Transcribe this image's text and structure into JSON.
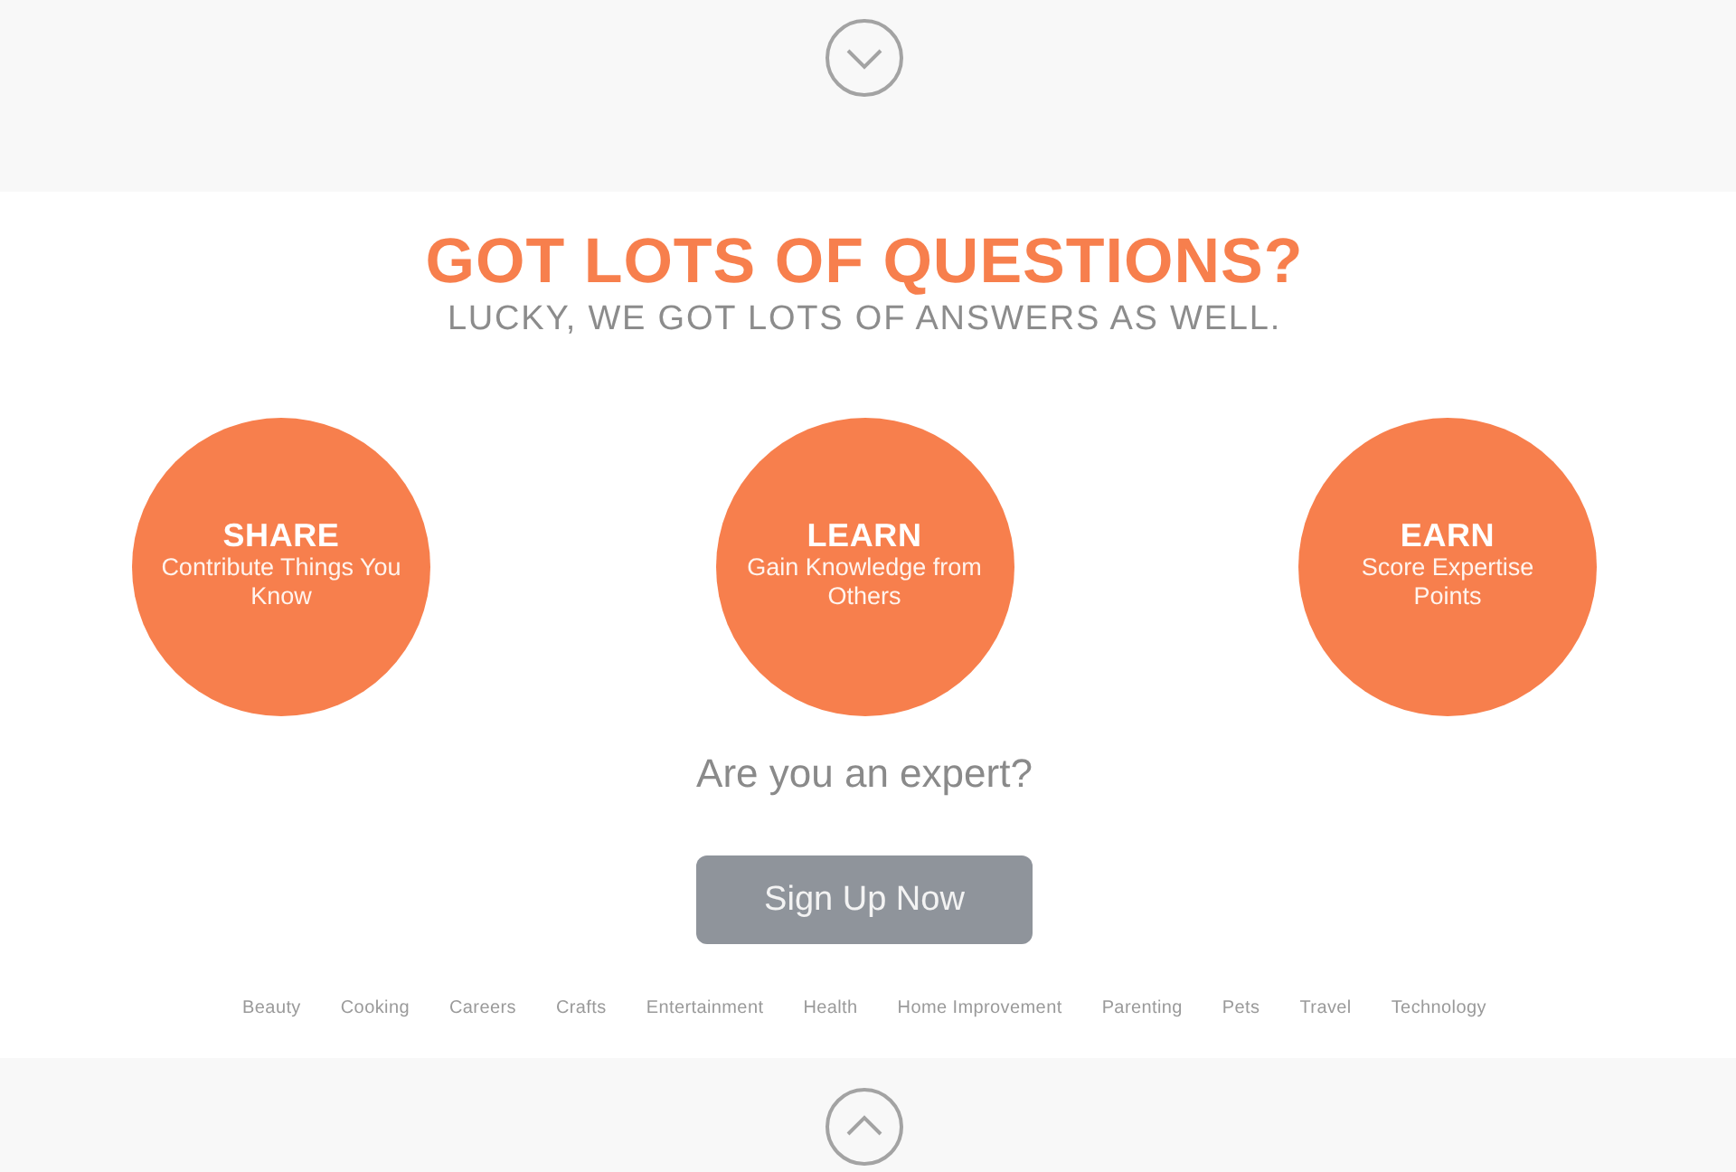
{
  "hero": {
    "title": "GOT LOTS OF QUESTIONS?",
    "subtitle": "LUCKY, WE GOT LOTS OF ANSWERS AS WELL."
  },
  "features": [
    {
      "title": "SHARE",
      "description": "Contribute Things You Know"
    },
    {
      "title": "LEARN",
      "description": "Gain Knowledge from Others"
    },
    {
      "title": "EARN",
      "description": "Score Expertise Points"
    }
  ],
  "prompt": "Are you an expert?",
  "signup_button": "Sign Up Now",
  "categories": [
    "Beauty",
    "Cooking",
    "Careers",
    "Crafts",
    "Entertainment",
    "Health",
    "Home Improvement",
    "Parenting",
    "Pets",
    "Travel",
    "Technology"
  ]
}
